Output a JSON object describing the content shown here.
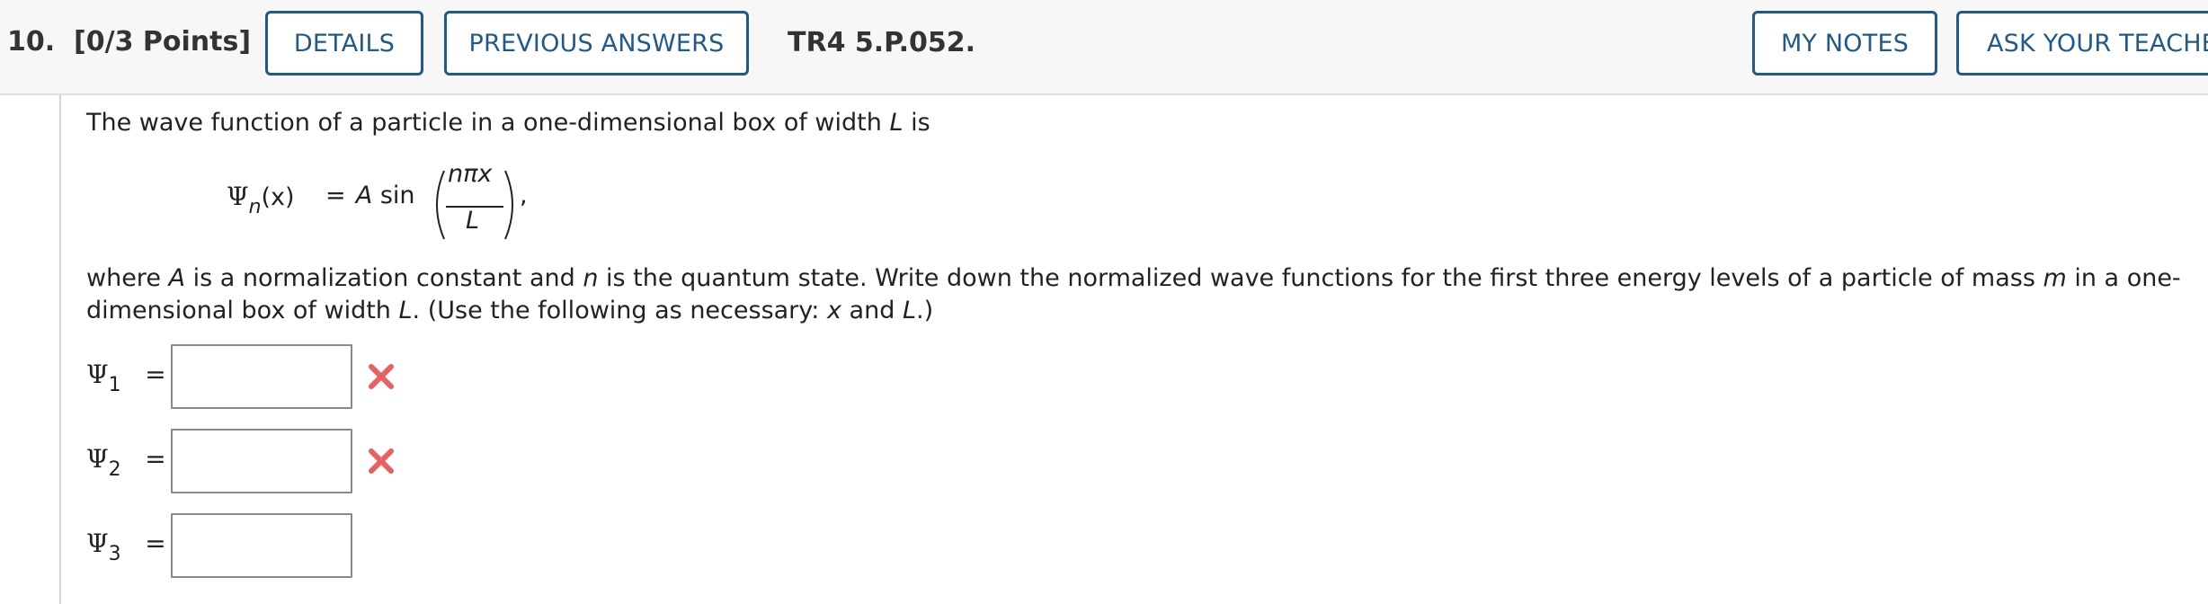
{
  "question": {
    "number_label": "10.",
    "points_label": "[0/3 Points]",
    "problem_code": "TR4 5.P.052."
  },
  "toolbar": {
    "details_label": "DETAILS",
    "previous_answers_label": "PREVIOUS ANSWERS",
    "my_notes_label": "MY NOTES",
    "ask_teacher_label": "ASK YOUR TEACHER"
  },
  "problem": {
    "intro_text_1": "The wave function of a particle in a one-dimensional box of width ",
    "intro_var": "L",
    "intro_text_2": " is",
    "equation": {
      "psi": "Ψ",
      "sub": "n",
      "arg": "(x)",
      "equals": "=",
      "amp": "A",
      "func": "sin",
      "numerator": "nπx",
      "denominator": "L",
      "trailing": ","
    },
    "body_line1": {
      "t1": "where ",
      "v1": "A",
      "t2": " is a normalization constant and ",
      "v2": "n",
      "t3": " is the quantum state. Write down the normalized wave functions for the first three energy levels of a particle of mass ",
      "v3": "m",
      "t4": " in a one-"
    },
    "body_line2": {
      "t1": "dimensional box of width ",
      "v1": "L",
      "t2": ". (Use the following as necessary: ",
      "v2": "x",
      "t3": " and ",
      "v3": "L",
      "t4": ".)"
    }
  },
  "answers": [
    {
      "symbol": "Ψ",
      "sub": "1",
      "equals": "=",
      "value": "",
      "status": "incorrect"
    },
    {
      "symbol": "Ψ",
      "sub": "2",
      "equals": "=",
      "value": "",
      "status": "incorrect"
    },
    {
      "symbol": "Ψ",
      "sub": "3",
      "equals": "=",
      "value": "",
      "status": "none"
    }
  ],
  "colors": {
    "button_border": "#1f5a8a",
    "incorrect_mark": "#e8605f"
  },
  "icons": {
    "incorrect": "x-icon"
  }
}
